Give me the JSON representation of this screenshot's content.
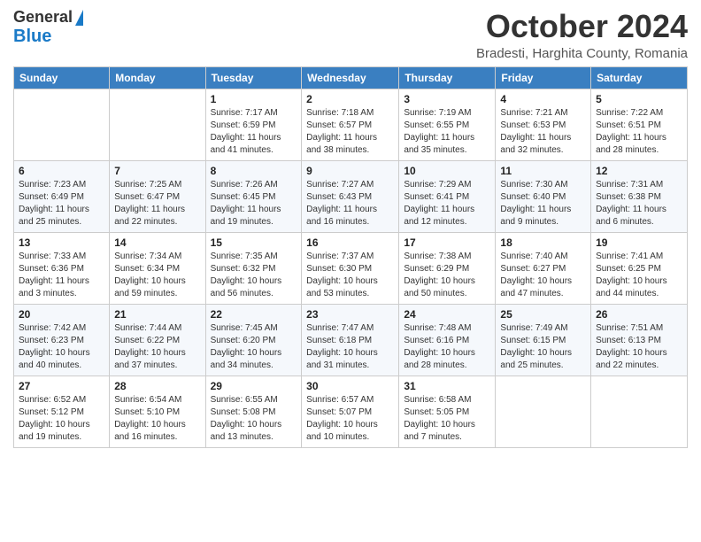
{
  "logo": {
    "line1": "General",
    "line2": "Blue"
  },
  "title": "October 2024",
  "subtitle": "Bradesti, Harghita County, Romania",
  "days_of_week": [
    "Sunday",
    "Monday",
    "Tuesday",
    "Wednesday",
    "Thursday",
    "Friday",
    "Saturday"
  ],
  "weeks": [
    [
      {
        "num": "",
        "info": ""
      },
      {
        "num": "",
        "info": ""
      },
      {
        "num": "1",
        "info": "Sunrise: 7:17 AM\nSunset: 6:59 PM\nDaylight: 11 hours and 41 minutes."
      },
      {
        "num": "2",
        "info": "Sunrise: 7:18 AM\nSunset: 6:57 PM\nDaylight: 11 hours and 38 minutes."
      },
      {
        "num": "3",
        "info": "Sunrise: 7:19 AM\nSunset: 6:55 PM\nDaylight: 11 hours and 35 minutes."
      },
      {
        "num": "4",
        "info": "Sunrise: 7:21 AM\nSunset: 6:53 PM\nDaylight: 11 hours and 32 minutes."
      },
      {
        "num": "5",
        "info": "Sunrise: 7:22 AM\nSunset: 6:51 PM\nDaylight: 11 hours and 28 minutes."
      }
    ],
    [
      {
        "num": "6",
        "info": "Sunrise: 7:23 AM\nSunset: 6:49 PM\nDaylight: 11 hours and 25 minutes."
      },
      {
        "num": "7",
        "info": "Sunrise: 7:25 AM\nSunset: 6:47 PM\nDaylight: 11 hours and 22 minutes."
      },
      {
        "num": "8",
        "info": "Sunrise: 7:26 AM\nSunset: 6:45 PM\nDaylight: 11 hours and 19 minutes."
      },
      {
        "num": "9",
        "info": "Sunrise: 7:27 AM\nSunset: 6:43 PM\nDaylight: 11 hours and 16 minutes."
      },
      {
        "num": "10",
        "info": "Sunrise: 7:29 AM\nSunset: 6:41 PM\nDaylight: 11 hours and 12 minutes."
      },
      {
        "num": "11",
        "info": "Sunrise: 7:30 AM\nSunset: 6:40 PM\nDaylight: 11 hours and 9 minutes."
      },
      {
        "num": "12",
        "info": "Sunrise: 7:31 AM\nSunset: 6:38 PM\nDaylight: 11 hours and 6 minutes."
      }
    ],
    [
      {
        "num": "13",
        "info": "Sunrise: 7:33 AM\nSunset: 6:36 PM\nDaylight: 11 hours and 3 minutes."
      },
      {
        "num": "14",
        "info": "Sunrise: 7:34 AM\nSunset: 6:34 PM\nDaylight: 10 hours and 59 minutes."
      },
      {
        "num": "15",
        "info": "Sunrise: 7:35 AM\nSunset: 6:32 PM\nDaylight: 10 hours and 56 minutes."
      },
      {
        "num": "16",
        "info": "Sunrise: 7:37 AM\nSunset: 6:30 PM\nDaylight: 10 hours and 53 minutes."
      },
      {
        "num": "17",
        "info": "Sunrise: 7:38 AM\nSunset: 6:29 PM\nDaylight: 10 hours and 50 minutes."
      },
      {
        "num": "18",
        "info": "Sunrise: 7:40 AM\nSunset: 6:27 PM\nDaylight: 10 hours and 47 minutes."
      },
      {
        "num": "19",
        "info": "Sunrise: 7:41 AM\nSunset: 6:25 PM\nDaylight: 10 hours and 44 minutes."
      }
    ],
    [
      {
        "num": "20",
        "info": "Sunrise: 7:42 AM\nSunset: 6:23 PM\nDaylight: 10 hours and 40 minutes."
      },
      {
        "num": "21",
        "info": "Sunrise: 7:44 AM\nSunset: 6:22 PM\nDaylight: 10 hours and 37 minutes."
      },
      {
        "num": "22",
        "info": "Sunrise: 7:45 AM\nSunset: 6:20 PM\nDaylight: 10 hours and 34 minutes."
      },
      {
        "num": "23",
        "info": "Sunrise: 7:47 AM\nSunset: 6:18 PM\nDaylight: 10 hours and 31 minutes."
      },
      {
        "num": "24",
        "info": "Sunrise: 7:48 AM\nSunset: 6:16 PM\nDaylight: 10 hours and 28 minutes."
      },
      {
        "num": "25",
        "info": "Sunrise: 7:49 AM\nSunset: 6:15 PM\nDaylight: 10 hours and 25 minutes."
      },
      {
        "num": "26",
        "info": "Sunrise: 7:51 AM\nSunset: 6:13 PM\nDaylight: 10 hours and 22 minutes."
      }
    ],
    [
      {
        "num": "27",
        "info": "Sunrise: 6:52 AM\nSunset: 5:12 PM\nDaylight: 10 hours and 19 minutes."
      },
      {
        "num": "28",
        "info": "Sunrise: 6:54 AM\nSunset: 5:10 PM\nDaylight: 10 hours and 16 minutes."
      },
      {
        "num": "29",
        "info": "Sunrise: 6:55 AM\nSunset: 5:08 PM\nDaylight: 10 hours and 13 minutes."
      },
      {
        "num": "30",
        "info": "Sunrise: 6:57 AM\nSunset: 5:07 PM\nDaylight: 10 hours and 10 minutes."
      },
      {
        "num": "31",
        "info": "Sunrise: 6:58 AM\nSunset: 5:05 PM\nDaylight: 10 hours and 7 minutes."
      },
      {
        "num": "",
        "info": ""
      },
      {
        "num": "",
        "info": ""
      }
    ]
  ]
}
